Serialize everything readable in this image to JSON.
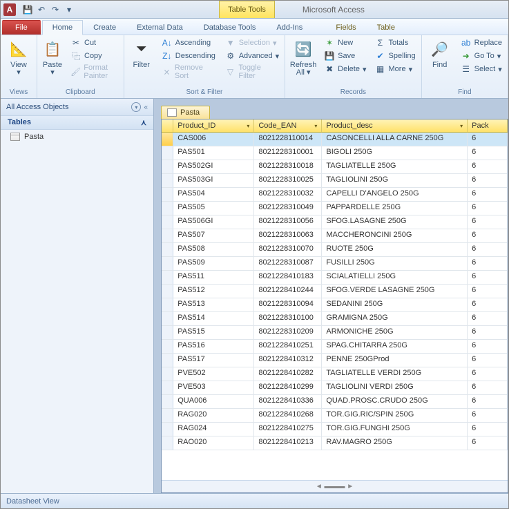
{
  "titlebar": {
    "app_letter": "A",
    "tool_tab": "Table Tools",
    "app_title": "Microsoft Access"
  },
  "tabs": {
    "file": "File",
    "home": "Home",
    "create": "Create",
    "external": "External Data",
    "dbtools": "Database Tools",
    "addins": "Add-Ins",
    "fields": "Fields",
    "table": "Table"
  },
  "ribbon": {
    "views": {
      "view": "View",
      "label": "Views"
    },
    "clipboard": {
      "paste": "Paste",
      "cut": "Cut",
      "copy": "Copy",
      "fp": "Format Painter",
      "label": "Clipboard"
    },
    "sort": {
      "filter": "Filter",
      "asc": "Ascending",
      "desc": "Descending",
      "remove": "Remove Sort",
      "selection": "Selection",
      "advanced": "Advanced",
      "toggle": "Toggle Filter",
      "label": "Sort & Filter"
    },
    "records": {
      "refresh": "Refresh All",
      "new": "New",
      "save": "Save",
      "delete": "Delete",
      "totals": "Totals",
      "spelling": "Spelling",
      "more": "More",
      "label": "Records"
    },
    "find": {
      "find": "Find",
      "replace": "Replace",
      "goto": "Go To",
      "select": "Select",
      "label": "Find"
    }
  },
  "nav": {
    "header": "All Access Objects",
    "section": "Tables",
    "item": "Pasta"
  },
  "sheet": {
    "tab": "Pasta",
    "cols": {
      "c1": "Product_ID",
      "c2": "Code_EAN",
      "c3": "Product_desc",
      "c4": "Pack"
    },
    "rows": [
      {
        "c1": "CAS006",
        "c2": "8021228110014",
        "c3": "CASONCELLI ALLA CARNE 250G",
        "c4": "6"
      },
      {
        "c1": "PAS501",
        "c2": "8021228310001",
        "c3": "BIGOLI 250G",
        "c4": "6"
      },
      {
        "c1": "PAS502GI",
        "c2": "8021228310018",
        "c3": "TAGLIATELLE 250G",
        "c4": "6"
      },
      {
        "c1": "PAS503GI",
        "c2": "8021228310025",
        "c3": "TAGLIOLINI 250G",
        "c4": "6"
      },
      {
        "c1": "PAS504",
        "c2": "8021228310032",
        "c3": "CAPELLI D'ANGELO 250G",
        "c4": "6"
      },
      {
        "c1": "PAS505",
        "c2": "8021228310049",
        "c3": "PAPPARDELLE 250G",
        "c4": "6"
      },
      {
        "c1": "PAS506GI",
        "c2": "8021228310056",
        "c3": "SFOG.LASAGNE 250G",
        "c4": "6"
      },
      {
        "c1": "PAS507",
        "c2": "8021228310063",
        "c3": "MACCHERONCINI 250G",
        "c4": "6"
      },
      {
        "c1": "PAS508",
        "c2": "8021228310070",
        "c3": "RUOTE 250G",
        "c4": "6"
      },
      {
        "c1": "PAS509",
        "c2": "8021228310087",
        "c3": "FUSILLI 250G",
        "c4": "6"
      },
      {
        "c1": "PAS511",
        "c2": "8021228410183",
        "c3": "SCIALATIELLI 250G",
        "c4": "6"
      },
      {
        "c1": "PAS512",
        "c2": "8021228410244",
        "c3": "SFOG.VERDE LASAGNE 250G",
        "c4": "6"
      },
      {
        "c1": "PAS513",
        "c2": "8021228310094",
        "c3": "SEDANINI 250G",
        "c4": "6"
      },
      {
        "c1": "PAS514",
        "c2": "8021228310100",
        "c3": "GRAMIGNA 250G",
        "c4": "6"
      },
      {
        "c1": "PAS515",
        "c2": "8021228310209",
        "c3": "ARMONICHE 250G",
        "c4": "6"
      },
      {
        "c1": "PAS516",
        "c2": "8021228410251",
        "c3": "SPAG.CHITARRA 250G",
        "c4": "6"
      },
      {
        "c1": "PAS517",
        "c2": "8021228410312",
        "c3": "PENNE 250GProd",
        "c4": "6"
      },
      {
        "c1": "PVE502",
        "c2": "8021228410282",
        "c3": "TAGLIATELLE VERDI 250G",
        "c4": "6"
      },
      {
        "c1": "PVE503",
        "c2": "8021228410299",
        "c3": "TAGLIOLINI VERDI 250G",
        "c4": "6"
      },
      {
        "c1": "QUA006",
        "c2": "8021228410336",
        "c3": "QUAD.PROSC.CRUDO 250G",
        "c4": "6"
      },
      {
        "c1": "RAG020",
        "c2": "8021228410268",
        "c3": "TOR.GIG.RIC/SPIN 250G",
        "c4": "6"
      },
      {
        "c1": "RAG024",
        "c2": "8021228410275",
        "c3": "TOR.GIG.FUNGHI 250G",
        "c4": "6"
      },
      {
        "c1": "RAO020",
        "c2": "8021228410213",
        "c3": "RAV.MAGRO 250G",
        "c4": "6"
      }
    ]
  },
  "status": "Datasheet View"
}
